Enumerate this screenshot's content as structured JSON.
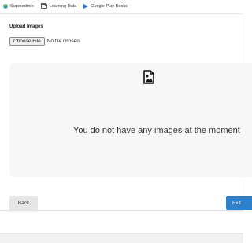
{
  "bookmarks": [
    {
      "label": "Superadmin",
      "icon": "globe-icon"
    },
    {
      "label": "Learning Data",
      "icon": "folder-icon"
    },
    {
      "label": "Google Play Books",
      "icon": "play-books-icon"
    }
  ],
  "upload": {
    "title": "Upload Images",
    "choose_label": "Choose File",
    "file_status": "No file chosen"
  },
  "empty_state": {
    "icon": "image-icon",
    "message": "You do not have any images at the moment"
  },
  "actions": {
    "back_label": "Back",
    "exit_label": "Exit"
  },
  "colors": {
    "primary": "#2f80c8",
    "secondary_button": "#e6e6e6",
    "dropzone_bg": "#f7f7f7"
  }
}
